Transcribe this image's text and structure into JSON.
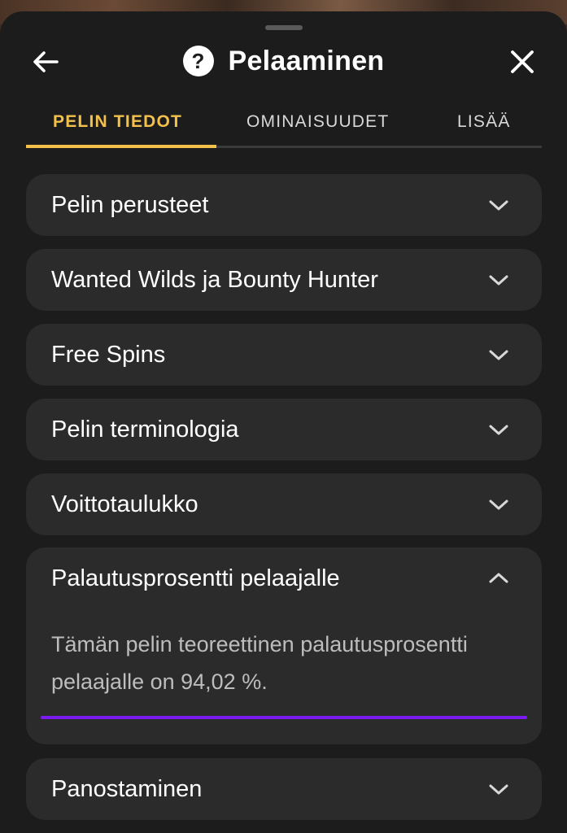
{
  "header": {
    "title": "Pelaaminen",
    "back_icon": "arrow-left-icon",
    "help_icon": "question-circle-icon",
    "help_glyph": "?",
    "close_icon": "close-icon"
  },
  "tabs": [
    {
      "label": "PELIN TIEDOT",
      "active": true
    },
    {
      "label": "OMINAISUUDET",
      "active": false
    },
    {
      "label": "LISÄÄ",
      "active": false
    }
  ],
  "accordion": [
    {
      "label": "Pelin perusteet",
      "expanded": false
    },
    {
      "label": "Wanted Wilds ja Bounty Hunter",
      "expanded": false
    },
    {
      "label": "Free Spins",
      "expanded": false
    },
    {
      "label": "Pelin terminologia",
      "expanded": false
    },
    {
      "label": "Voittotaulukko",
      "expanded": false
    },
    {
      "label": "Palautusprosentti pelaajalle",
      "expanded": true,
      "body": "Tämän pelin teoreettinen palautusprosentti pelaajalle on 94,02 %."
    },
    {
      "label": "Panostaminen",
      "expanded": false
    }
  ],
  "colors": {
    "accent": "#f2c04b",
    "sheet_bg": "#1c1c1c",
    "card_bg": "#2b2b2b",
    "highlight": "#7a1cf0"
  }
}
